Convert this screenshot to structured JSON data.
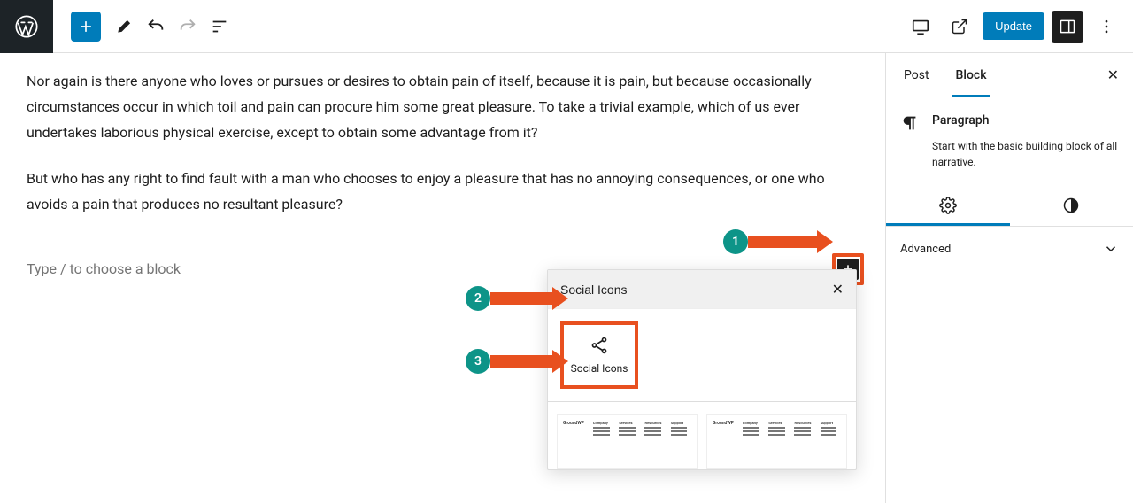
{
  "topbar": {
    "update_label": "Update"
  },
  "editor": {
    "para1": "Nor again is there anyone who loves or pursues or desires to obtain pain of itself, because it is pain, but because occasionally circumstances occur in which toil and pain can procure him some great pleasure. To take a trivial example, which of us ever undertakes laborious physical exercise, except to obtain some advantage from it?",
    "para2": "But who has any right to find fault with a man who chooses to enjoy a pleasure that has no annoying consequences, or one who avoids a pain that produces no resultant pleasure?",
    "placeholder": "Type / to choose a block"
  },
  "inserter": {
    "search_value": "Social Icons",
    "result_label": "Social Icons"
  },
  "sidebar": {
    "tabs": {
      "post": "Post",
      "block": "Block"
    },
    "block_title": "Paragraph",
    "block_desc": "Start with the basic building block of all narrative.",
    "advanced": "Advanced"
  },
  "callouts": {
    "c1": "1",
    "c2": "2",
    "c3": "3"
  }
}
